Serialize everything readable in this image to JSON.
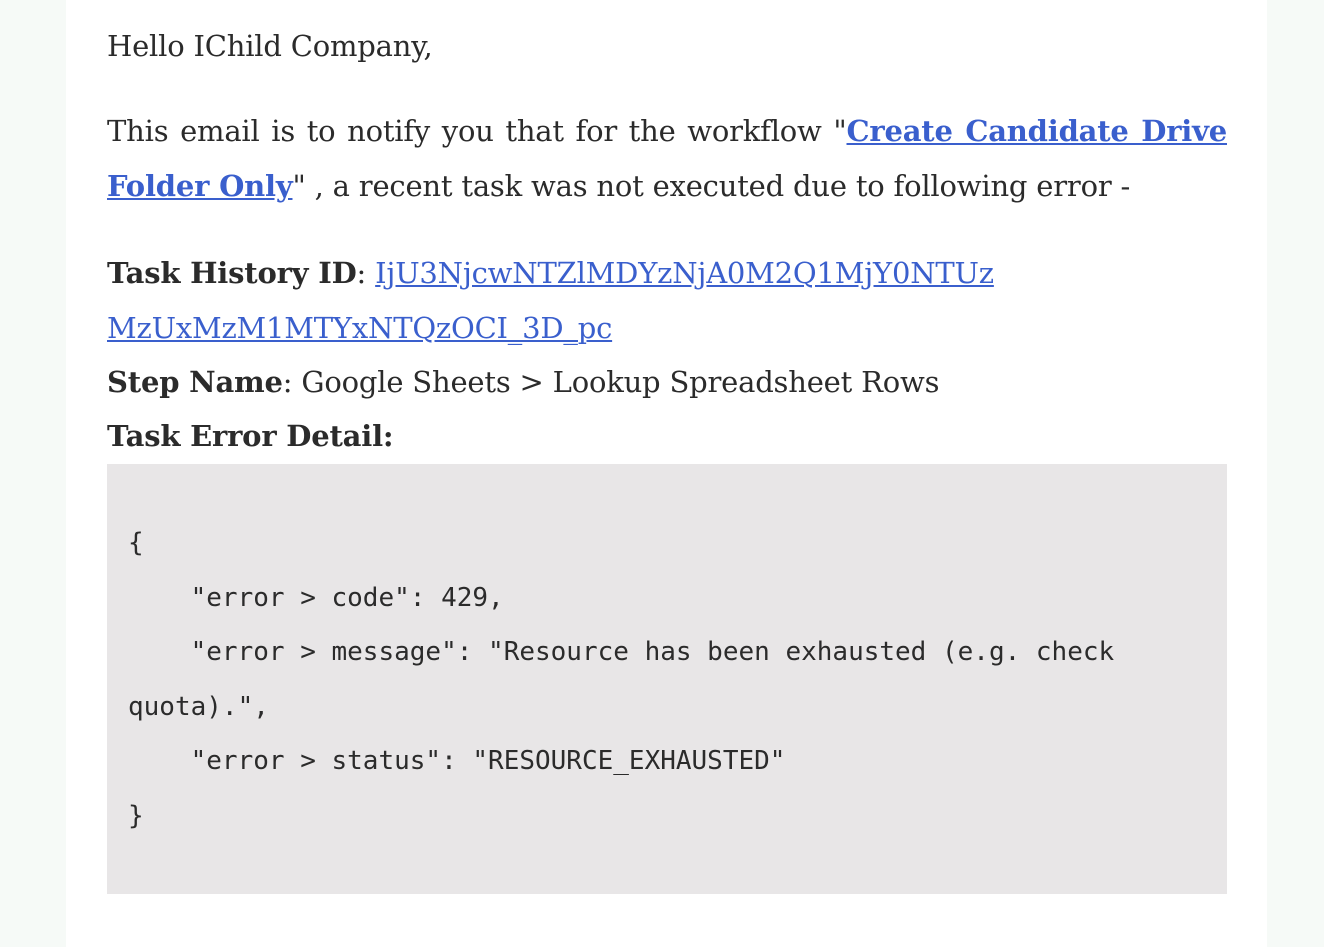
{
  "email": {
    "greeting": "Hello IChild Company,",
    "notice_prefix": "This email is to notify you that for the workflow \"",
    "workflow_name": "Create Candidate Drive Folder Only",
    "notice_suffix": "\" , a recent task was not executed due to following error -",
    "task_history": {
      "label": "Task History ID",
      "separator": ": ",
      "value": "IjU3NjcwNTZlMDYzNjA0M2Q1MjY0NTUzMzUxMzM1MTYxNTQzOCI_3D_pc"
    },
    "step": {
      "label": "Step Name",
      "separator": ": ",
      "value": "Google Sheets > Lookup Spreadsheet Rows"
    },
    "error_detail_label": "Task Error Detail:",
    "error_detail_code": "{\n    \"error > code\": 429,\n    \"error > message\": \"Resource has been exhausted (e.g. check quota).\",\n    \"error > status\": \"RESOURCE_EXHAUSTED\"\n}"
  },
  "colors": {
    "link": "#3a5fcd",
    "text": "#2b2b2b",
    "code_background": "#e8e6e7",
    "page_background": "#ffffff",
    "outer_background": "#f6faf7"
  }
}
